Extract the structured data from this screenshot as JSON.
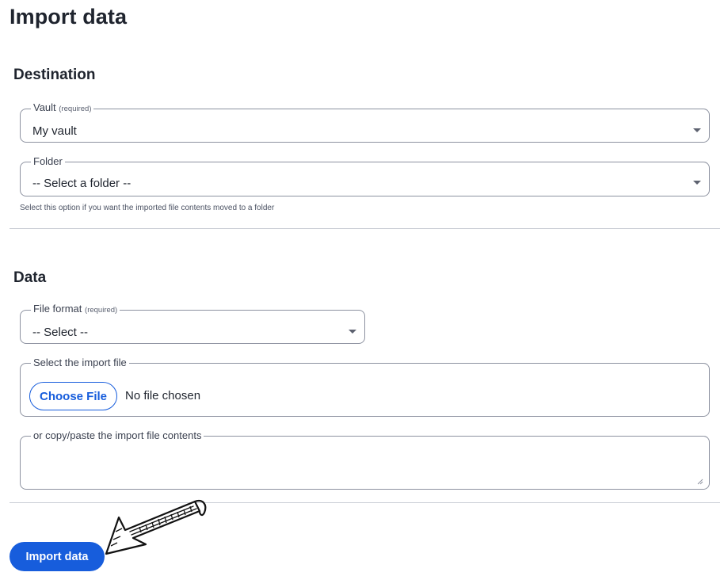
{
  "page": {
    "title": "Import data"
  },
  "destination": {
    "title": "Destination",
    "vault": {
      "label": "Vault",
      "required_tag": "(required)",
      "value": "My vault"
    },
    "folder": {
      "label": "Folder",
      "value": "-- Select a folder --",
      "hint": "Select this option if you want the imported file contents moved to a folder"
    }
  },
  "data_section": {
    "title": "Data",
    "file_format": {
      "label": "File format",
      "required_tag": "(required)",
      "value": "-- Select --"
    },
    "import_file": {
      "label": "Select the import file",
      "choose_button": "Choose File",
      "status": "No file chosen"
    },
    "paste": {
      "label": "or copy/paste the import file contents",
      "value": ""
    }
  },
  "actions": {
    "import_label": "Import data"
  },
  "annotation": {
    "icon": "hand-drawn-arrow-icon"
  },
  "colors": {
    "primary": "#175ddc",
    "text": "#1f242e",
    "border": "#8d92a0",
    "divider": "#c9ccd4"
  }
}
